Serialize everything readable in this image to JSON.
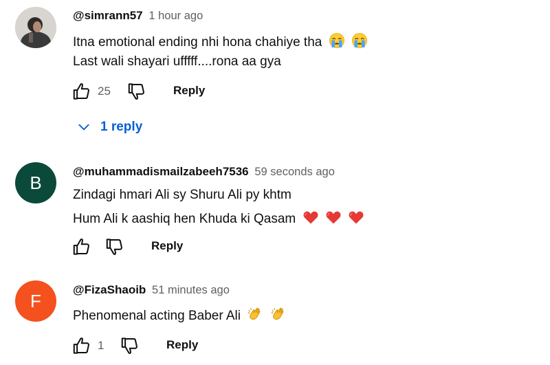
{
  "comments": [
    {
      "handle": "@simrann57",
      "time": "1 hour ago",
      "lines": [
        "Itna emotional ending nhi hona chahiye tha",
        "Last wali shayari ufffff....rona aa gya"
      ],
      "emoji_icons": [
        "crying-face-icon",
        "crying-face-icon"
      ],
      "like_count": "25",
      "reply_label": "Reply",
      "replies_label": "1 reply"
    },
    {
      "handle": "@muhammadismailzabeeh7536",
      "time": "59 seconds ago",
      "avatar_letter": "B",
      "avatar_color": "#0b4a3a",
      "lines": [
        "Zindagi hmari Ali sy Shuru Ali py khtm",
        "Hum Ali k aashiq hen Khuda ki Qasam"
      ],
      "emoji_icons": [
        "red-heart-icon",
        "red-heart-icon",
        "red-heart-icon"
      ],
      "like_count": "",
      "reply_label": "Reply"
    },
    {
      "handle": "@FizaShaoib",
      "time": "51 minutes ago",
      "avatar_letter": "F",
      "avatar_color": "#f4511e",
      "lines": [
        "Phenomenal acting Baber Ali"
      ],
      "emoji_icons": [
        "clapping-hands-icon",
        "clapping-hands-icon"
      ],
      "like_count": "1",
      "reply_label": "Reply"
    }
  ],
  "colors": {
    "link_blue": "#065fd4",
    "secondary_text": "#606060"
  }
}
